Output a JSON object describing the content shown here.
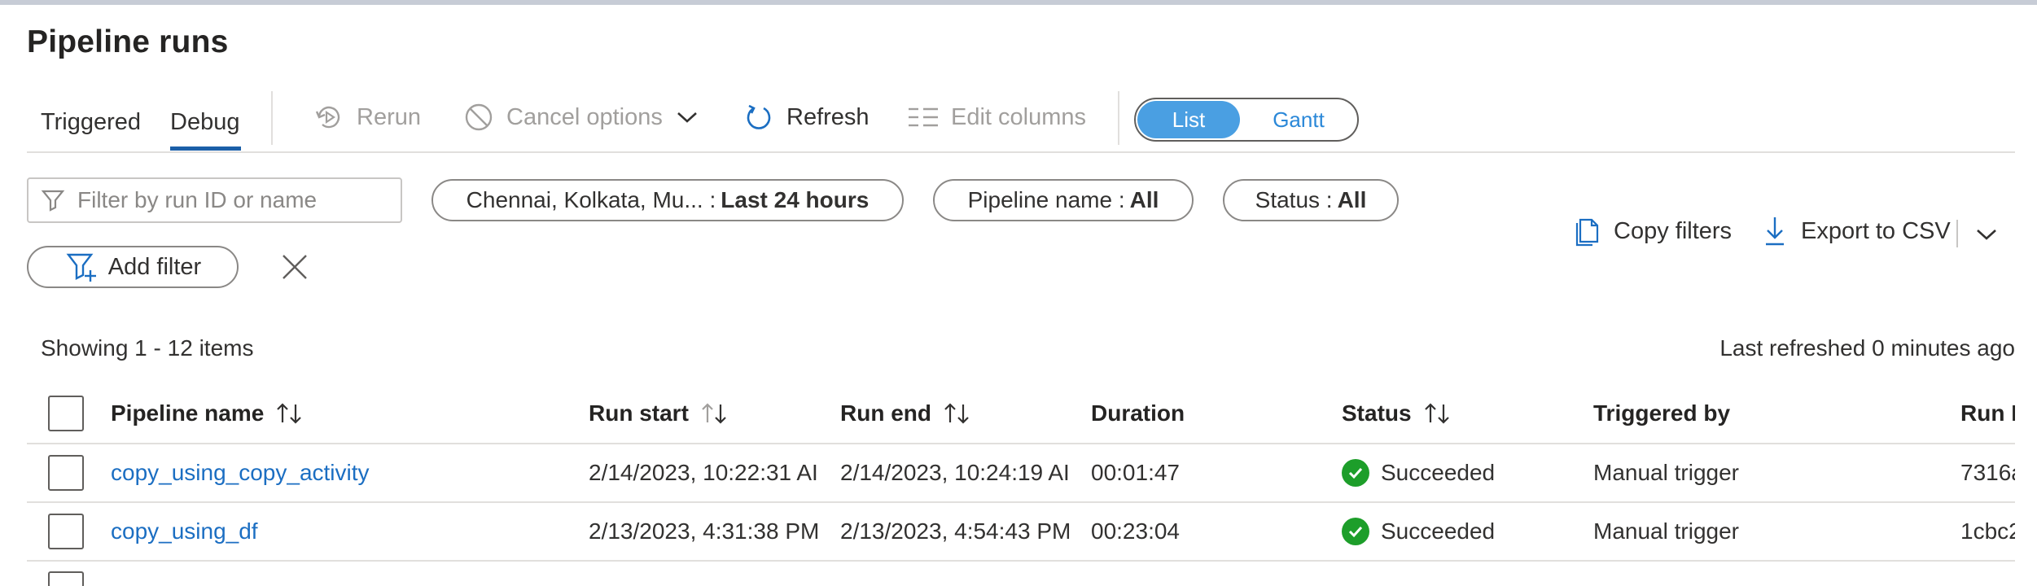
{
  "page": {
    "title": "Pipeline runs"
  },
  "tabs": [
    {
      "label": "Triggered",
      "active": false
    },
    {
      "label": "Debug",
      "active": true
    }
  ],
  "toolbar": {
    "rerun": "Rerun",
    "cancel_options": "Cancel options",
    "refresh": "Refresh",
    "edit_columns": "Edit columns",
    "view_toggle": {
      "list": "List",
      "gantt": "Gantt",
      "selected": "List"
    }
  },
  "filters": {
    "search_placeholder": "Filter by run ID or name",
    "timezone_prefix": "Chennai, Kolkata, Mu... :",
    "timezone_value": "Last 24 hours",
    "pipeline_prefix": "Pipeline name :",
    "pipeline_value": "All",
    "status_prefix": "Status :",
    "status_value": "All",
    "add_filter": "Add filter",
    "copy_filters": "Copy filters",
    "export_csv": "Export to CSV"
  },
  "info": {
    "showing": "Showing 1 - 12 items",
    "last_refreshed": "Last refreshed 0 minutes ago"
  },
  "table": {
    "columns": [
      "Pipeline name",
      "Run start",
      "Run end",
      "Duration",
      "Status",
      "Triggered by",
      "Run I"
    ],
    "rows": [
      {
        "pipeline": "copy_using_copy_activity",
        "run_start": "2/14/2023, 10:22:31 AI",
        "run_end": "2/14/2023, 10:24:19 AI",
        "duration": "00:01:47",
        "status": "Succeeded",
        "triggered_by": "Manual trigger",
        "run_id": "7316a"
      },
      {
        "pipeline": "copy_using_df",
        "run_start": "2/13/2023, 4:31:38 PM",
        "run_end": "2/13/2023, 4:54:43 PM",
        "duration": "00:23:04",
        "status": "Succeeded",
        "triggered_by": "Manual trigger",
        "run_id": "1cbc2"
      }
    ]
  },
  "colors": {
    "accent": "#1b5fa8",
    "toggle_on": "#4a9fe2",
    "link": "#1b6ec2",
    "success": "#1d9e2a"
  }
}
